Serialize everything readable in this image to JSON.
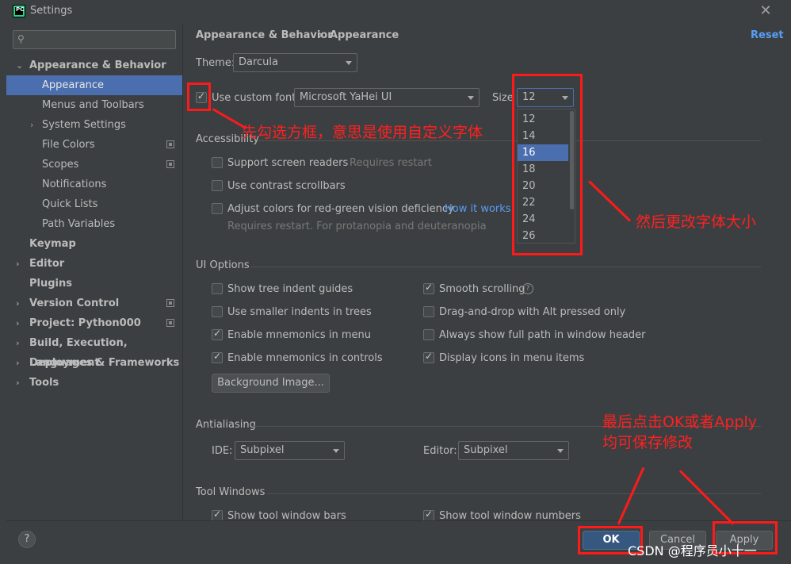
{
  "window": {
    "title": "Settings"
  },
  "sidebar": {
    "search_placeholder": "Q-",
    "items": [
      {
        "label": "Appearance & Behavior",
        "bold": true,
        "expanded": true
      },
      {
        "label": "Appearance",
        "selected": true
      },
      {
        "label": "Menus and Toolbars"
      },
      {
        "label": "System Settings"
      },
      {
        "label": "File Colors"
      },
      {
        "label": "Scopes"
      },
      {
        "label": "Notifications"
      },
      {
        "label": "Quick Lists"
      },
      {
        "label": "Path Variables"
      },
      {
        "label": "Keymap"
      },
      {
        "label": "Editor"
      },
      {
        "label": "Plugins"
      },
      {
        "label": "Version Control"
      },
      {
        "label": "Project: Python000"
      },
      {
        "label": "Build, Execution, Deployment"
      },
      {
        "label": "Languages & Frameworks"
      },
      {
        "label": "Tools"
      }
    ]
  },
  "header": {
    "breadcrumb_parent": "Appearance & Behavior",
    "breadcrumb_sep": "›",
    "breadcrumb_current": "Appearance",
    "reset": "Reset"
  },
  "appearance": {
    "theme_label": "Theme:",
    "theme_value": "Darcula",
    "custom_font_label": "Use custom font:",
    "font_value": "Microsoft YaHei UI",
    "size_label": "Size",
    "size_value": "12",
    "size_options": [
      "12",
      "14",
      "16",
      "18",
      "20",
      "22",
      "24",
      "26"
    ],
    "size_selected": "16"
  },
  "accessibility": {
    "title": "Accessibility",
    "screen_readers": "Support screen readers",
    "requires_restart": "Requires restart",
    "contrast_scrollbars": "Use contrast scrollbars",
    "adjust_colors": "Adjust colors for red-green vision deficiency",
    "how_it_works": "How it works",
    "restart_note": "Requires restart. For protanopia and deuteranopia"
  },
  "ui_options": {
    "title": "UI Options",
    "tree_indent": "Show tree indent guides",
    "smaller_indents": "Use smaller indents in trees",
    "mnemonics_menu": "Enable mnemonics in menu",
    "mnemonics_controls": "Enable mnemonics in controls",
    "background_image": "Background Image...",
    "smooth_scrolling": "Smooth scrolling",
    "drag_drop": "Drag-and-drop with Alt pressed only",
    "full_path": "Always show full path in window header",
    "display_icons": "Display icons in menu items"
  },
  "antialiasing": {
    "title": "Antialiasing",
    "ide_label": "IDE:",
    "ide_value": "Subpixel",
    "editor_label": "Editor:",
    "editor_value": "Subpixel"
  },
  "tool_windows": {
    "title": "Tool Windows",
    "tool_window_bars": "Show tool window bars",
    "tool_window_numbers": "Show tool window numbers"
  },
  "buttons": {
    "help": "?",
    "ok": "OK",
    "cancel": "Cancel",
    "apply": "Apply"
  },
  "annotations": {
    "step1": "先勾选方框，意思是使用自定义字体",
    "step2": "然后更改字体大小",
    "step3_line1": "最后点击OK或者Apply",
    "step3_line2": "均可保存修改"
  },
  "watermark": "CSDN @程序员小十一",
  "colors": {
    "accent": "#4b6eaf",
    "annotation": "#ff1a1a",
    "link": "#589df6"
  }
}
